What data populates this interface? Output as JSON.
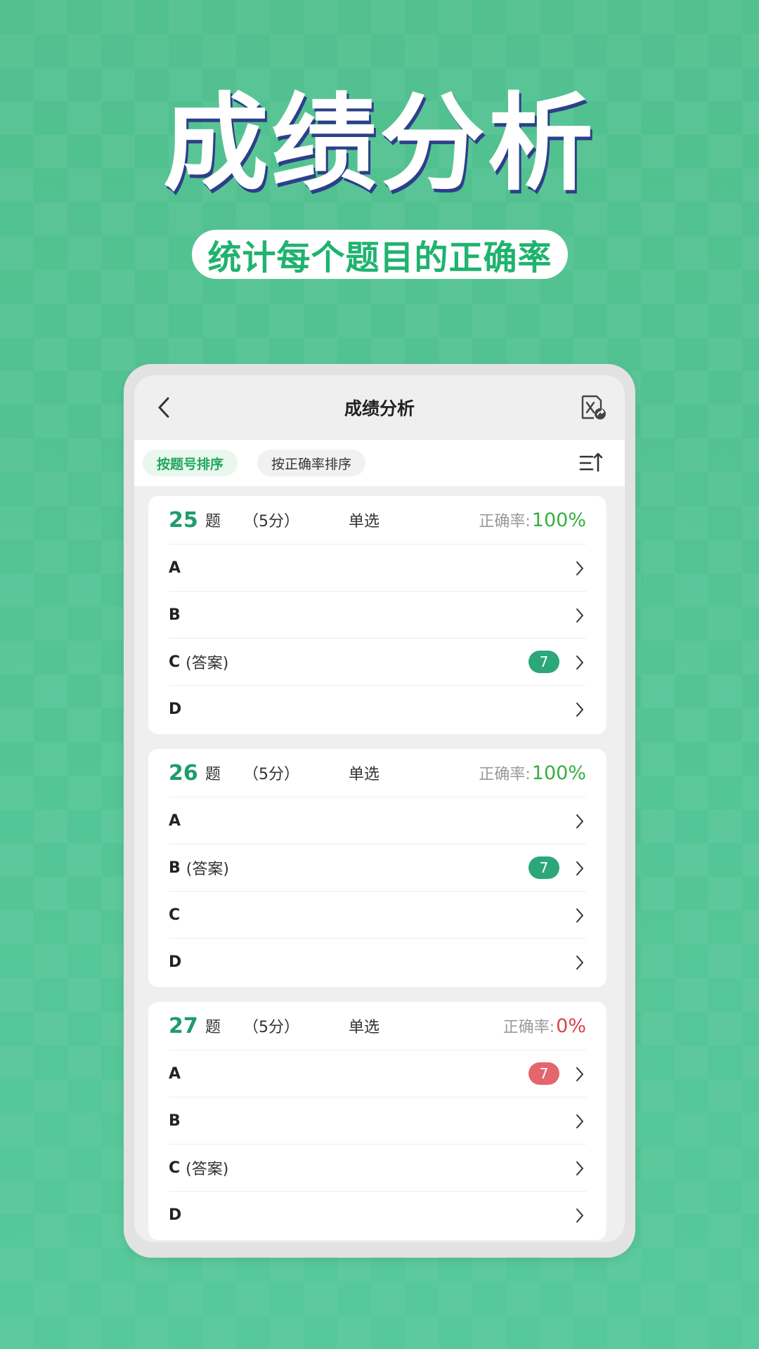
{
  "hero": {
    "title": "成绩分析",
    "subtitle": "统计每个题目的正确率"
  },
  "navbar": {
    "title": "成绩分析",
    "back_icon": "chevron-left-icon",
    "export_icon": "excel-export-icon"
  },
  "sort": {
    "by_number": "按题号排序",
    "by_accuracy": "按正确率排序",
    "toggle_icon": "sort-order-icon"
  },
  "colors": {
    "accent_green": "#1e9c6c",
    "rate_good": "#35b041",
    "rate_bad": "#d9434c",
    "badge_green": "#2ba77a",
    "badge_red": "#e3666f"
  },
  "questions": [
    {
      "number": "25",
      "unit": "题",
      "score": "（5分）",
      "type": "单选",
      "rate_label": "正确率:",
      "rate_value": "100%",
      "options": [
        {
          "letter": "A",
          "note": "",
          "count": ""
        },
        {
          "letter": "B",
          "note": "",
          "count": ""
        },
        {
          "letter": "C",
          "note": "(答案)",
          "count": "7"
        },
        {
          "letter": "D",
          "note": "",
          "count": ""
        }
      ]
    },
    {
      "number": "26",
      "unit": "题",
      "score": "（5分）",
      "type": "单选",
      "rate_label": "正确率:",
      "rate_value": "100%",
      "options": [
        {
          "letter": "A",
          "note": "",
          "count": ""
        },
        {
          "letter": "B",
          "note": "(答案)",
          "count": "7"
        },
        {
          "letter": "C",
          "note": "",
          "count": ""
        },
        {
          "letter": "D",
          "note": "",
          "count": ""
        }
      ]
    },
    {
      "number": "27",
      "unit": "题",
      "score": "（5分）",
      "type": "单选",
      "rate_label": "正确率:",
      "rate_value": "0%",
      "options": [
        {
          "letter": "A",
          "note": "",
          "count": "7"
        },
        {
          "letter": "B",
          "note": "",
          "count": ""
        },
        {
          "letter": "C",
          "note": "(答案)",
          "count": ""
        },
        {
          "letter": "D",
          "note": "",
          "count": ""
        }
      ]
    }
  ]
}
